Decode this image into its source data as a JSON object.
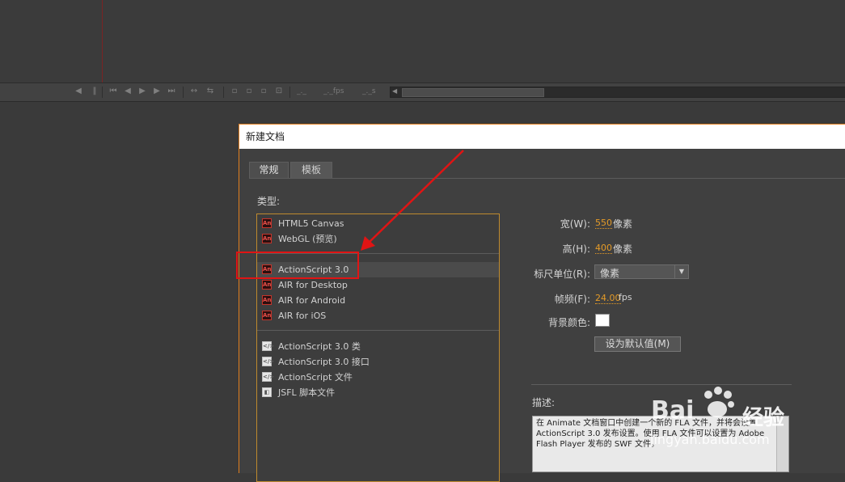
{
  "timeline": {
    "frame_text": "_._",
    "fps_text": "_._fps",
    "time_text": "_._s"
  },
  "dialog": {
    "title": "新建文档",
    "tabs": [
      {
        "label": "常规"
      },
      {
        "label": "模板"
      }
    ],
    "type_label": "类型:",
    "types": [
      {
        "label": "HTML5 Canvas",
        "icon": "an-icon"
      },
      {
        "label": "WebGL (预览)",
        "icon": "an-icon"
      },
      {
        "label": "ActionScript 3.0",
        "icon": "an-icon"
      },
      {
        "label": "AIR for Desktop",
        "icon": "an-icon"
      },
      {
        "label": "AIR for Android",
        "icon": "an-icon"
      },
      {
        "label": "AIR for iOS",
        "icon": "an-icon"
      },
      {
        "label": "ActionScript 3.0 类",
        "icon": "script-icon"
      },
      {
        "label": "ActionScript 3.0 接口",
        "icon": "script-icon"
      },
      {
        "label": "ActionScript 文件",
        "icon": "script-icon"
      },
      {
        "label": "JSFL 脚本文件",
        "icon": "jsfl-icon"
      }
    ],
    "selected_type": "ActionScript 3.0",
    "icon_text": "An",
    "props": {
      "width_label": "宽(W):",
      "width_value": "550",
      "width_unit": "像素",
      "height_label": "高(H):",
      "height_value": "400",
      "height_unit": "像素",
      "ruler_label": "标尺单位(R):",
      "ruler_value": "像素",
      "fps_label": "帧频(F):",
      "fps_value": "24.00",
      "fps_unit": "fps",
      "bg_label": "背景颜色:",
      "bg_color": "#ffffff",
      "default_button": "设为默认值(M)"
    },
    "description_label": "描述:",
    "description_text": "在 Animate 文档窗口中创建一个新的 FLA 文件，并将会设置 ActionScript 3.0 发布设置。使用 FLA 文件可以设置为 Adobe Flash Player 发布的 SWF 文件。"
  },
  "watermark": {
    "brand": "Bai",
    "brand_cn": "经验",
    "url": "jingyan.baidu.com"
  },
  "colors": {
    "accent_orange": "#e07e1e",
    "annotation_red": "#e01414",
    "value_orange": "#e59b27"
  }
}
